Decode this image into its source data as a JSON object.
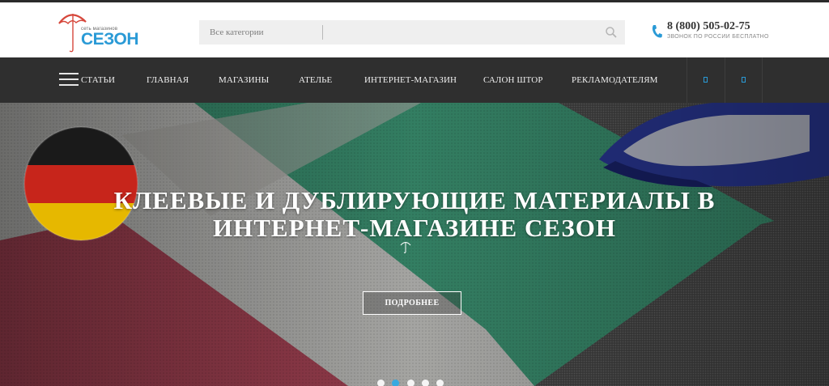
{
  "header": {
    "logo": {
      "small_text": "сеть магазинов",
      "big_text": "СЕЗОН",
      "icon": "umbrella-icon",
      "brand_color": "#2a9ad6"
    },
    "search": {
      "category_label": "Все категории",
      "placeholder": "",
      "button_icon": "search-icon"
    },
    "phone": {
      "icon": "phone-icon",
      "number": "8 (800) 505-02-75",
      "subtitle": "ЗВОНОК ПО РОССИИ БЕСПЛАТНО"
    }
  },
  "nav": {
    "menu_icon": "hamburger-icon",
    "items": [
      {
        "label": "СТАТЬИ"
      },
      {
        "label": "ГЛАВНАЯ"
      },
      {
        "label": "МАГАЗИНЫ"
      },
      {
        "label": "АТЕЛЬЕ"
      },
      {
        "label": "ИНТЕРНЕТ-МАГАЗИН"
      },
      {
        "label": "САЛОН ШТОР"
      },
      {
        "label": "РЕКЛАМОДАТЕЛЯМ"
      }
    ],
    "icon_cells": [
      "user-icon",
      "cart-icon"
    ]
  },
  "hero": {
    "title": "КЛЕЕВЫЕ И ДУБЛИРУЮЩИЕ МАТЕРИАЛЫ В ИНТЕРНЕТ-МАГАЗИНЕ СЕЗОН",
    "mark_icon": "umbrella-mark-icon",
    "button_label": "ПОДРОБНЕЕ",
    "slides_count": 5,
    "active_slide": 2
  },
  "colors": {
    "accent": "#37a9e0",
    "nav_bg": "#2f2f2f",
    "green_fabric": "#3f9a78",
    "red_fabric": "#b2485b"
  }
}
